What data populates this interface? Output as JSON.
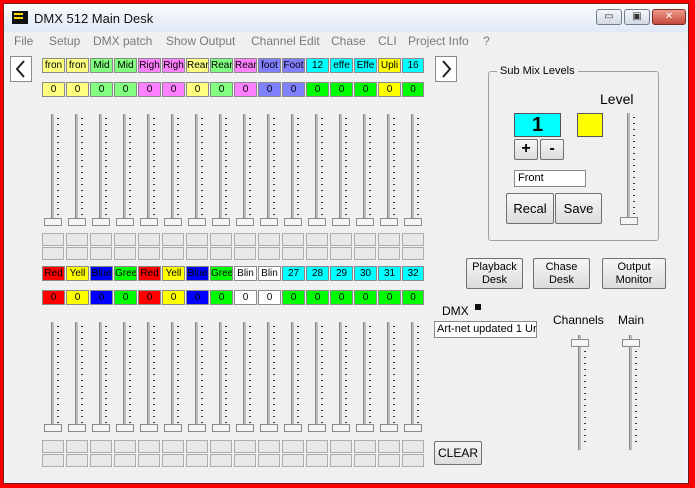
{
  "window": {
    "title": "DMX 512 Main Desk",
    "caption": {
      "min": "▭",
      "max": "▣",
      "close": "✕"
    }
  },
  "menu": [
    "File",
    "Setup",
    "DMX patch",
    "Show Output",
    "Channel Edit",
    "Chase",
    "CLI",
    "Project Info",
    "?"
  ],
  "nav": {
    "prev": "<",
    "next": ">"
  },
  "top_bank": {
    "labels": [
      "fron",
      "fron",
      "Mid",
      "Mid",
      "Righ",
      "Righ",
      "Rear",
      "Rear",
      "Rear",
      "foot",
      "Foot",
      "12",
      "effe",
      "Effe",
      "Upli",
      "16"
    ],
    "values": [
      "0",
      "0",
      "0",
      "0",
      "0",
      "0",
      "0",
      "0",
      "0",
      "0",
      "0",
      "0",
      "0",
      "0",
      "0",
      "0"
    ],
    "label_colors": [
      "#ffff80",
      "#ffff80",
      "#80ff80",
      "#80ff80",
      "#ff80ff",
      "#ff80ff",
      "#ffff80",
      "#80ff80",
      "#ff80ff",
      "#8080ff",
      "#8080ff",
      "#00ffff",
      "#00ffff",
      "#00ffff",
      "#ffff00",
      "#00ffff"
    ],
    "value_colors": [
      "#ffff80",
      "#ffff80",
      "#80ff80",
      "#80ff80",
      "#ff80ff",
      "#ff80ff",
      "#ffff80",
      "#80ff80",
      "#ff80ff",
      "#8080ff",
      "#8080ff",
      "#00ff00",
      "#00ff00",
      "#00ff00",
      "#ffff00",
      "#00ff00"
    ]
  },
  "bottom_bank": {
    "labels": [
      "Red",
      "Yell",
      "Blue",
      "Gree",
      "Red",
      "Yell",
      "Blue",
      "Gree",
      "Blin",
      "Blin",
      "27",
      "28",
      "29",
      "30",
      "31",
      "32"
    ],
    "values": [
      "0",
      "0",
      "0",
      "0",
      "0",
      "0",
      "0",
      "0",
      "0",
      "0",
      "0",
      "0",
      "0",
      "0",
      "0",
      "0"
    ],
    "label_colors": [
      "#ff0000",
      "#ffff00",
      "#0000ff",
      "#00ff00",
      "#ff0000",
      "#ffff00",
      "#0000ff",
      "#00ff00",
      "#ffffff",
      "#ffffff",
      "#00ffff",
      "#00ffff",
      "#00ffff",
      "#00ffff",
      "#00ffff",
      "#00ffff"
    ],
    "value_colors": [
      "#ff0000",
      "#ffff00",
      "#0000ff",
      "#00ff00",
      "#ff0000",
      "#ffff00",
      "#0000ff",
      "#00ff00",
      "#ffffff",
      "#ffffff",
      "#00ff00",
      "#00ff00",
      "#00ff00",
      "#00ff00",
      "#00ff00",
      "#00ff00"
    ]
  },
  "submix": {
    "title": "Sub Mix Levels",
    "level_label": "Level",
    "number": "1",
    "plus": "+",
    "minus": "-",
    "name": "Front",
    "recall": "Recal",
    "save": "Save",
    "number_color": "#00ffff",
    "swatch_color": "#ffff00"
  },
  "buttons": {
    "playback": "Playback Desk",
    "chase": "Chase Desk",
    "output": "Output Monitor",
    "clear": "CLEAR"
  },
  "dmx": {
    "label": "DMX",
    "status": "Art-net updated  1 Ur"
  },
  "masters": {
    "channels": "Channels",
    "main": "Main"
  }
}
